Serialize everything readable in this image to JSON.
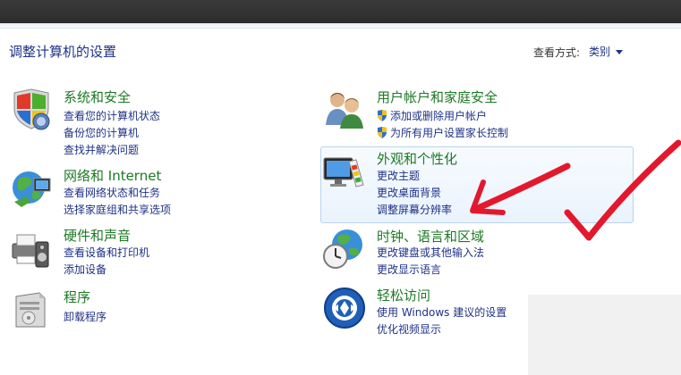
{
  "header": {
    "title": "调整计算机的设置",
    "view_by_label": "查看方式:",
    "view_by_value": "类别"
  },
  "categories": [
    {
      "title": "系统和安全",
      "links": [
        "查看您的计算机状态",
        "备份您的计算机",
        "查找并解决问题"
      ]
    },
    {
      "title": "网络和 Internet",
      "links": [
        "查看网络状态和任务",
        "选择家庭组和共享选项"
      ]
    },
    {
      "title": "硬件和声音",
      "links": [
        "查看设备和打印机",
        "添加设备"
      ]
    },
    {
      "title": "程序",
      "links": [
        "卸载程序"
      ]
    },
    {
      "title": "用户帐户和家庭安全",
      "links": [
        "添加或删除用户帐户",
        "为所有用户设置家长控制"
      ]
    },
    {
      "title": "外观和个性化",
      "links": [
        "更改主题",
        "更改桌面背景",
        "调整屏幕分辨率"
      ]
    },
    {
      "title": "时钟、语言和区域",
      "links": [
        "更改键盘或其他输入法",
        "更改显示语言"
      ]
    },
    {
      "title": "轻松访问",
      "links": [
        "使用 Windows 建议的设置",
        "优化视频显示"
      ]
    }
  ],
  "colors": {
    "title_green": "#1c7a24",
    "link_blue": "#1e3287",
    "annotation_red": "#e3182d"
  }
}
